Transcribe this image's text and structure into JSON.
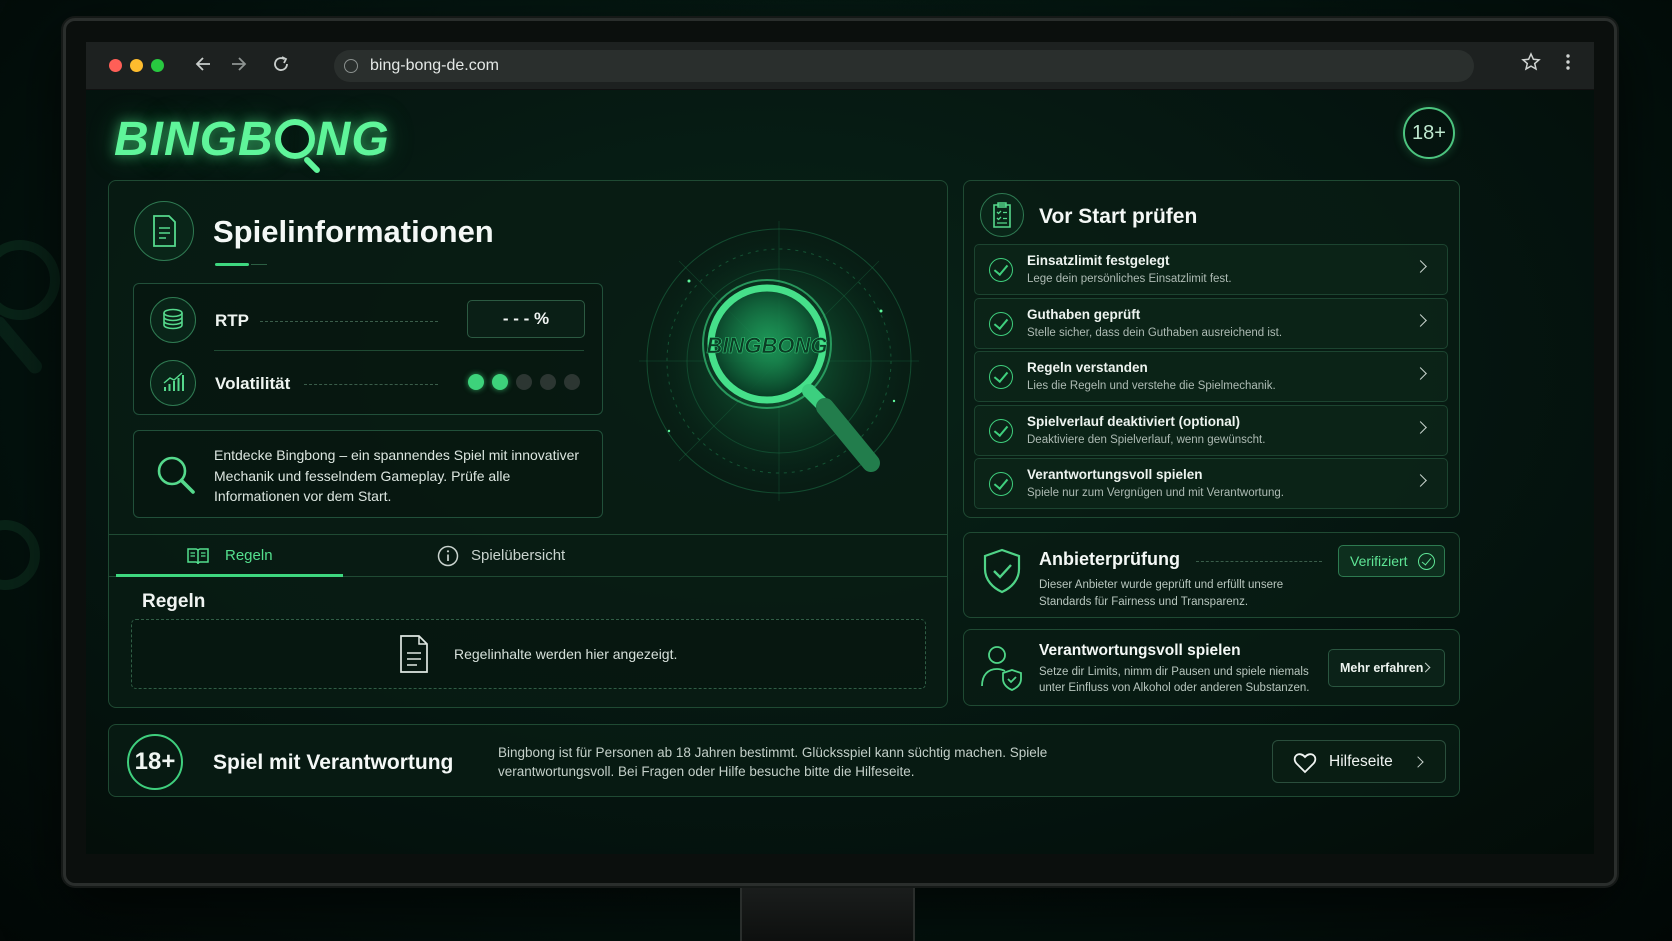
{
  "browser": {
    "url": "bing-bong-de.com"
  },
  "header": {
    "logo_left": "BINGB",
    "logo_right": "NG",
    "age_badge": "18+"
  },
  "game_info": {
    "title": "Spielinformationen",
    "rtp_label": "RTP",
    "rtp_value": "- - - %",
    "volatility_label": "Volatilität",
    "volatility_level": 2,
    "volatility_max": 5,
    "description": "Entdecke Bingbong – ein spannendes Spiel mit innovativer Mechanik und fesselndem Gameplay. Prüfe alle Informationen vor dem Start.",
    "hero_logo_text": "BINGBONG",
    "tabs": [
      {
        "label": "Regeln",
        "active": true
      },
      {
        "label": "Spielübersicht",
        "active": false
      }
    ],
    "rules_heading": "Regeln",
    "rules_placeholder": "Regelinhalte werden hier angezeigt."
  },
  "checklist": {
    "title": "Vor Start prüfen",
    "items": [
      {
        "title": "Einsatzlimit festgelegt",
        "subtitle": "Lege dein persönliches Einsatzlimit fest."
      },
      {
        "title": "Guthaben geprüft",
        "subtitle": "Stelle sicher, dass dein Guthaben ausreichend ist."
      },
      {
        "title": "Regeln verstanden",
        "subtitle": "Lies die Regeln und verstehe die Spielmechanik."
      },
      {
        "title": "Spielverlauf deaktiviert (optional)",
        "subtitle": "Deaktiviere den Spielverlauf, wenn gewünscht."
      },
      {
        "title": "Verantwortungsvoll spielen",
        "subtitle": "Spiele nur zum Vergnügen und mit Verantwortung."
      }
    ]
  },
  "provider": {
    "title": "Anbieterprüfung",
    "text": "Dieser Anbieter wurde geprüft und erfüllt unsere Standards für Fairness und Transparenz.",
    "badge": "Verifiziert"
  },
  "responsible": {
    "title": "Verantwortungsvoll spielen",
    "text": "Setze dir Limits, nimm dir Pausen und spiele niemals unter Einfluss von Alkohol oder anderen Substanzen.",
    "button": "Mehr erfahren"
  },
  "footer": {
    "age": "18+",
    "title": "Spiel mit Verantwortung",
    "text": "Bingbong ist für Personen ab 18 Jahren bestimmt. Glücksspiel kann süchtig machen. Spiele verantwortungsvoll. Bei Fragen oder Hilfe besuche bitte die Hilfeseite.",
    "help_button": "Hilfeseite"
  },
  "colors": {
    "accent": "#3ed77f",
    "logo": "#5ff59a",
    "panel_border": "#1f4a33",
    "background": "#041510"
  },
  "icons": {
    "document": "document-icon",
    "coins": "coins-icon",
    "chart": "chart-icon",
    "search": "search-icon",
    "clipboard": "clipboard-check-icon",
    "shield": "shield-check-icon",
    "person_shield": "person-shield-icon",
    "heart": "heart-icon",
    "book": "book-icon",
    "info": "info-icon"
  }
}
